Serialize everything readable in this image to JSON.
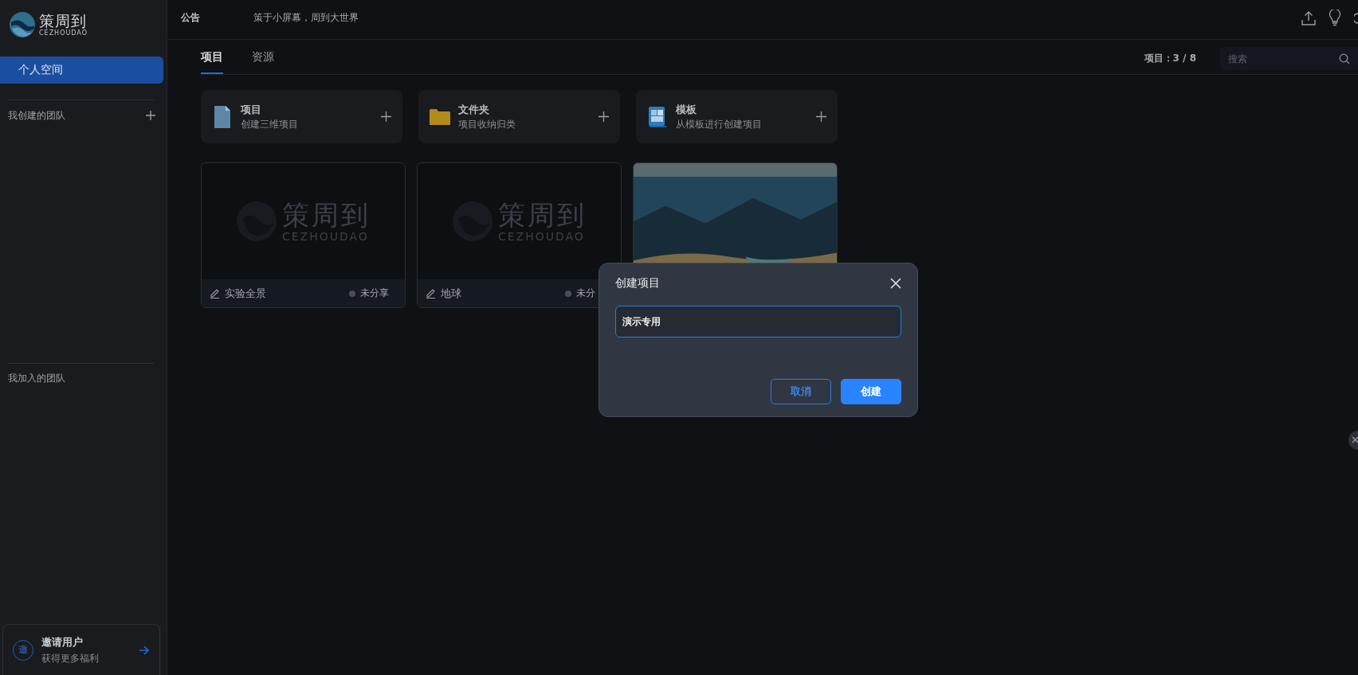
{
  "logo": {
    "name": "策周到",
    "subtitle": "CEZHOUDAO"
  },
  "sidebar": {
    "items": [
      {
        "label": "个人空间",
        "selected": true
      }
    ],
    "sections": [
      {
        "title": "我创建的团队",
        "can_add": true
      },
      {
        "title": "我加入的团队",
        "can_add": false
      }
    ],
    "invite": {
      "badge": "邀",
      "title": "邀请用户",
      "subtitle": "获得更多福利"
    }
  },
  "header": {
    "notice_label": "公告",
    "notice": "策于小屏幕，周到大世界"
  },
  "tabs": [
    {
      "label": "项目",
      "selected": true
    },
    {
      "label": "资源",
      "selected": false
    }
  ],
  "project_count": "项目：3 / 8",
  "search": {
    "placeholder": "搜索"
  },
  "actions": [
    {
      "kind": "file",
      "title": "项目",
      "subtitle": "创建三维项目"
    },
    {
      "kind": "folder",
      "title": "文件夹",
      "subtitle": "项目收纳归类"
    },
    {
      "kind": "template",
      "title": "模板",
      "subtitle": "从模板进行创建项目"
    }
  ],
  "projects": [
    {
      "kind": "placeholder",
      "placeholder_logo": {
        "name": "策周到",
        "subtitle": "CEZHOUDAO"
      },
      "name": "实验全景",
      "status": "未分享",
      "shared": false
    },
    {
      "kind": "placeholder",
      "placeholder_logo": {
        "name": "策周到",
        "subtitle": "CEZHOUDAO"
      },
      "name": "地球",
      "status": "未分",
      "shared": false
    },
    {
      "kind": "picture"
    }
  ],
  "dialog": {
    "title": "创建项目",
    "value": "演示专用",
    "buttons": [
      {
        "label": "取消",
        "kind": "secondary"
      },
      {
        "label": "创建",
        "kind": "primary"
      }
    ]
  }
}
